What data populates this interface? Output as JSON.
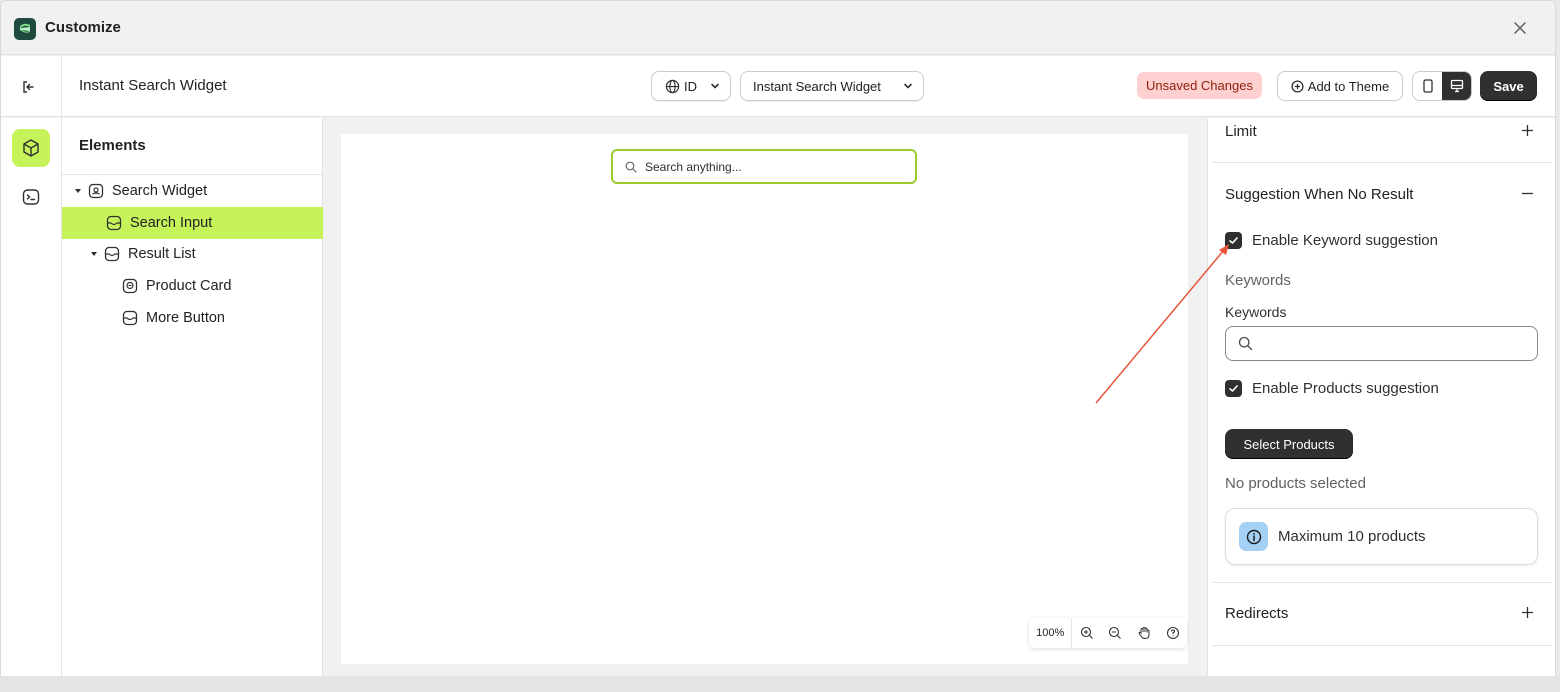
{
  "window": {
    "title": "Customize"
  },
  "toolbar": {
    "page_name": "Instant Search Widget",
    "language": "ID",
    "template": "Instant Search Widget",
    "unsaved_label": "Unsaved Changes",
    "add_to_theme_label": "Add to Theme",
    "save_label": "Save"
  },
  "elements_panel": {
    "header": "Elements",
    "tree": [
      {
        "label": "Search Widget",
        "level": 0,
        "expanded": true,
        "selected": false
      },
      {
        "label": "Search Input",
        "level": 1,
        "expanded": false,
        "selected": true
      },
      {
        "label": "Result List",
        "level": 1,
        "expanded": true,
        "selected": false
      },
      {
        "label": "Product Card",
        "level": 2,
        "expanded": false,
        "selected": false
      },
      {
        "label": "More Button",
        "level": 2,
        "expanded": false,
        "selected": false
      }
    ]
  },
  "canvas": {
    "search_placeholder": "Search anything...",
    "zoom": "100%"
  },
  "settings": {
    "limit_header": "Limit",
    "suggestion_header": "Suggestion When No Result",
    "enable_keyword_label": "Enable Keyword suggestion",
    "enable_keyword_checked": true,
    "keywords_section_label": "Keywords",
    "keywords_field_label": "Keywords",
    "keywords_value": "",
    "enable_products_label": "Enable Products suggestion",
    "enable_products_checked": true,
    "select_products_label": "Select Products",
    "no_products_text": "No products selected",
    "info_text": "Maximum 10 products",
    "redirects_header": "Redirects"
  },
  "colors": {
    "accent": "#c6f25a",
    "primary_button": "#303030",
    "unsaved_bg": "#fed1d0",
    "unsaved_text": "#8e1f0b",
    "info_badge": "#a6d1f6",
    "annotation_arrow": "#e8543c"
  },
  "icons": {
    "app_logo": "app-logo-icon",
    "close": "close-icon",
    "exit": "exit-icon",
    "globe": "globe-icon",
    "chevron": "chevron-down-icon",
    "plus_circle": "plus-circle-icon",
    "mobile": "mobile-icon",
    "desktop": "desktop-icon",
    "elements": "cube-icon",
    "code": "terminal-icon",
    "search": "search-icon",
    "info": "info-icon"
  }
}
